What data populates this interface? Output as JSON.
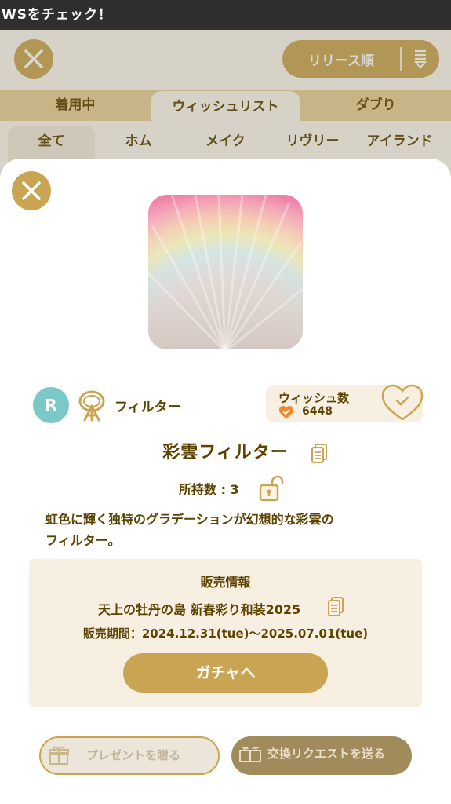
{
  "status_bar": {
    "text": "WSをチェック！"
  },
  "header": {
    "sort_label": "リリース順"
  },
  "tabs": [
    "着用中",
    "ウィッシュリスト",
    "ダブり"
  ],
  "subtabs": [
    "全て",
    "ホム",
    "メイク",
    "リヴリー",
    "アイランド"
  ],
  "item": {
    "rarity": "R",
    "type_label": "フィルター",
    "name": "彩雲フィルター",
    "owned_label": "所持数 : 3",
    "description_line1": "虹色に輝く独特のグラデーションが幻想的な彩雲の",
    "description_line2": "フィルター。"
  },
  "wish": {
    "title": "ウィッシュ数",
    "count": "6448"
  },
  "sales": {
    "title": "販売情報",
    "event": "天上の牡丹の島 新春彩り和装2025",
    "period": "販売期間：2024.12.31(tue)〜2025.07.01(tue)",
    "gacha_label": "ガチャへ"
  },
  "actions": {
    "present_label": "プレゼントを贈る",
    "trade_label": "交換リクエストを送る"
  },
  "colors": {
    "gold": "#c9a553",
    "brown_text": "#5c4300",
    "rarity_teal": "#7cc7c7",
    "heart_orange": "#f0892a"
  },
  "icons": [
    "close-icon",
    "sort-icon",
    "filter-type-icon",
    "heart-icon",
    "wish-heart-button",
    "copy-icon",
    "unlock-icon",
    "gift-icon",
    "trade-icon"
  ]
}
